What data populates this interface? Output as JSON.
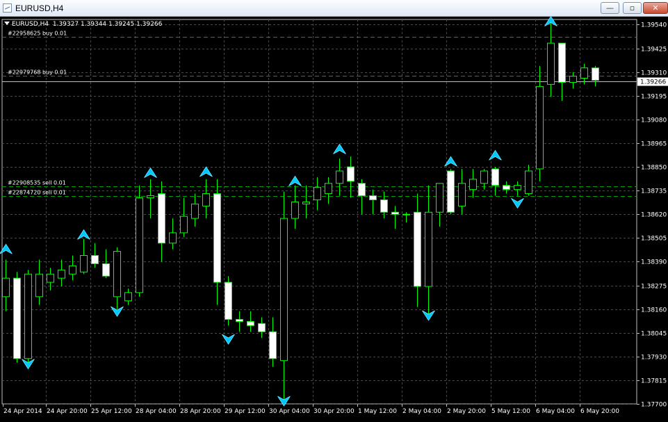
{
  "window": {
    "title": "EURUSD,H4",
    "buttons": {
      "minimize": "—",
      "restore": "▫",
      "close": "✕"
    }
  },
  "symbol_info": {
    "symbol": "EURUSD,H4",
    "ohlc": "1.39327 1.39344 1.39245 1.39266"
  },
  "colors": {
    "background": "#000000",
    "grid": "#4a4a4a",
    "candle": "#00ff00",
    "bull_body": "#000000",
    "bear_body": "#ffffff",
    "text": "#ffffff",
    "arrow": "#00c8ff",
    "order_line": "#00a000"
  },
  "chart_data": {
    "type": "candlestick",
    "symbol": "EURUSD",
    "timeframe": "H4",
    "y_ticks": [
      "1.39540",
      "1.39425",
      "1.39310",
      "1.39195",
      "1.39080",
      "1.38965",
      "1.38850",
      "1.38735",
      "1.38620",
      "1.38505",
      "1.38390",
      "1.38275",
      "1.38160",
      "1.38045",
      "1.37930",
      "1.37815",
      "1.37700"
    ],
    "y_range": [
      1.377,
      1.39565
    ],
    "x_labels": [
      "24 Apr 2014",
      "24 Apr 20:00",
      "25 Apr 12:00",
      "28 Apr 04:00",
      "28 Apr 20:00",
      "29 Apr 12:00",
      "30 Apr 04:00",
      "30 Apr 20:00",
      "1 May 12:00",
      "2 May 04:00",
      "2 May 20:00",
      "5 May 12:00",
      "6 May 04:00",
      "6 May 20:00"
    ],
    "current_price": "1.39266",
    "candles": [
      {
        "o": 1.3822,
        "h": 1.384,
        "l": 1.3815,
        "c": 1.3831
      },
      {
        "o": 1.3831,
        "h": 1.3834,
        "l": 1.379,
        "c": 1.3792
      },
      {
        "o": 1.3792,
        "h": 1.3835,
        "l": 1.379,
        "c": 1.3833
      },
      {
        "o": 1.3822,
        "h": 1.384,
        "l": 1.3818,
        "c": 1.3833
      },
      {
        "o": 1.3829,
        "h": 1.3836,
        "l": 1.3825,
        "c": 1.3833
      },
      {
        "o": 1.3831,
        "h": 1.384,
        "l": 1.3827,
        "c": 1.3835
      },
      {
        "o": 1.3833,
        "h": 1.3842,
        "l": 1.383,
        "c": 1.3837
      },
      {
        "o": 1.3834,
        "h": 1.385,
        "l": 1.3833,
        "c": 1.3842
      },
      {
        "o": 1.3842,
        "h": 1.3848,
        "l": 1.3836,
        "c": 1.3838
      },
      {
        "o": 1.3838,
        "h": 1.3845,
        "l": 1.3831,
        "c": 1.3832
      },
      {
        "o": 1.3822,
        "h": 1.3846,
        "l": 1.3816,
        "c": 1.3844
      },
      {
        "o": 1.382,
        "h": 1.3826,
        "l": 1.3818,
        "c": 1.3824
      },
      {
        "o": 1.3824,
        "h": 1.3876,
        "l": 1.3822,
        "c": 1.387
      },
      {
        "o": 1.387,
        "h": 1.3879,
        "l": 1.386,
        "c": 1.3871
      },
      {
        "o": 1.3872,
        "h": 1.3878,
        "l": 1.3839,
        "c": 1.3848
      },
      {
        "o": 1.3848,
        "h": 1.386,
        "l": 1.3845,
        "c": 1.3853
      },
      {
        "o": 1.3853,
        "h": 1.387,
        "l": 1.3851,
        "c": 1.3861
      },
      {
        "o": 1.386,
        "h": 1.3872,
        "l": 1.3856,
        "c": 1.3867
      },
      {
        "o": 1.3866,
        "h": 1.3879,
        "l": 1.386,
        "c": 1.3872
      },
      {
        "o": 1.3872,
        "h": 1.3879,
        "l": 1.3818,
        "c": 1.3829
      },
      {
        "o": 1.3829,
        "h": 1.3832,
        "l": 1.3808,
        "c": 1.3811
      },
      {
        "o": 1.3811,
        "h": 1.3815,
        "l": 1.3805,
        "c": 1.381
      },
      {
        "o": 1.381,
        "h": 1.3815,
        "l": 1.3805,
        "c": 1.3808
      },
      {
        "o": 1.3809,
        "h": 1.3812,
        "l": 1.3802,
        "c": 1.3805
      },
      {
        "o": 1.3805,
        "h": 1.3812,
        "l": 1.3788,
        "c": 1.3792
      },
      {
        "o": 1.3791,
        "h": 1.3873,
        "l": 1.3771,
        "c": 1.386
      },
      {
        "o": 1.386,
        "h": 1.3876,
        "l": 1.3855,
        "c": 1.3868
      },
      {
        "o": 1.3867,
        "h": 1.3876,
        "l": 1.386,
        "c": 1.3868
      },
      {
        "o": 1.3869,
        "h": 1.388,
        "l": 1.3864,
        "c": 1.3875
      },
      {
        "o": 1.3872,
        "h": 1.388,
        "l": 1.3867,
        "c": 1.3877
      },
      {
        "o": 1.3877,
        "h": 1.3889,
        "l": 1.3871,
        "c": 1.3883
      },
      {
        "o": 1.3885,
        "h": 1.389,
        "l": 1.387,
        "c": 1.3878
      },
      {
        "o": 1.3877,
        "h": 1.3879,
        "l": 1.3862,
        "c": 1.3871
      },
      {
        "o": 1.3871,
        "h": 1.3874,
        "l": 1.3862,
        "c": 1.3869
      },
      {
        "o": 1.3869,
        "h": 1.3873,
        "l": 1.386,
        "c": 1.3863
      },
      {
        "o": 1.3863,
        "h": 1.3866,
        "l": 1.3855,
        "c": 1.3862
      },
      {
        "o": 1.3862,
        "h": 1.3863,
        "l": 1.3858,
        "c": 1.3862
      },
      {
        "o": 1.3863,
        "h": 1.3872,
        "l": 1.3817,
        "c": 1.3827
      },
      {
        "o": 1.3827,
        "h": 1.3876,
        "l": 1.3811,
        "c": 1.3863
      },
      {
        "o": 1.3863,
        "h": 1.3877,
        "l": 1.3856,
        "c": 1.3877
      },
      {
        "o": 1.3883,
        "h": 1.3884,
        "l": 1.3862,
        "c": 1.3863
      },
      {
        "o": 1.3866,
        "h": 1.3884,
        "l": 1.3862,
        "c": 1.3877
      },
      {
        "o": 1.3874,
        "h": 1.3884,
        "l": 1.387,
        "c": 1.3879
      },
      {
        "o": 1.3877,
        "h": 1.3884,
        "l": 1.3874,
        "c": 1.3883
      },
      {
        "o": 1.3884,
        "h": 1.3885,
        "l": 1.3871,
        "c": 1.3876
      },
      {
        "o": 1.3876,
        "h": 1.3878,
        "l": 1.3872,
        "c": 1.3874
      },
      {
        "o": 1.3874,
        "h": 1.3878,
        "l": 1.3871,
        "c": 1.3876
      },
      {
        "o": 1.3872,
        "h": 1.3886,
        "l": 1.3871,
        "c": 1.3883
      },
      {
        "o": 1.3884,
        "h": 1.3934,
        "l": 1.3878,
        "c": 1.3924
      },
      {
        "o": 1.3925,
        "h": 1.396,
        "l": 1.3919,
        "c": 1.3945
      },
      {
        "o": 1.3945,
        "h": 1.3945,
        "l": 1.3917,
        "c": 1.3926
      },
      {
        "o": 1.3926,
        "h": 1.3931,
        "l": 1.3923,
        "c": 1.3929
      },
      {
        "o": 1.3928,
        "h": 1.3935,
        "l": 1.3925,
        "c": 1.3933
      },
      {
        "o": 1.3933,
        "h": 1.3934,
        "l": 1.3924,
        "c": 1.3927
      }
    ],
    "order_lines": [
      {
        "label": "#22958625 buy 0.01",
        "price": 1.3948
      },
      {
        "label": "#22979768 buy 0.01",
        "price": 1.39293
      },
      {
        "label": "#22908535 sell 0.01",
        "price": 1.38756
      },
      {
        "label": "#22874720 sell 0.01",
        "price": 1.3871
      }
    ],
    "arrows_up": [
      {
        "i": 0,
        "price": 1.38475
      },
      {
        "i": 7,
        "price": 1.38545
      },
      {
        "i": 13,
        "price": 1.38845
      },
      {
        "i": 18,
        "price": 1.3885
      },
      {
        "i": 26,
        "price": 1.38805
      },
      {
        "i": 30,
        "price": 1.3896
      },
      {
        "i": 40,
        "price": 1.389
      },
      {
        "i": 44,
        "price": 1.3893
      },
      {
        "i": 49,
        "price": 1.3958
      }
    ],
    "arrows_down": [
      {
        "i": 2,
        "price": 1.3787
      },
      {
        "i": 10,
        "price": 1.38125
      },
      {
        "i": 20,
        "price": 1.3799
      },
      {
        "i": 25,
        "price": 1.3769
      },
      {
        "i": 38,
        "price": 1.38105
      },
      {
        "i": 46,
        "price": 1.3865
      }
    ]
  }
}
